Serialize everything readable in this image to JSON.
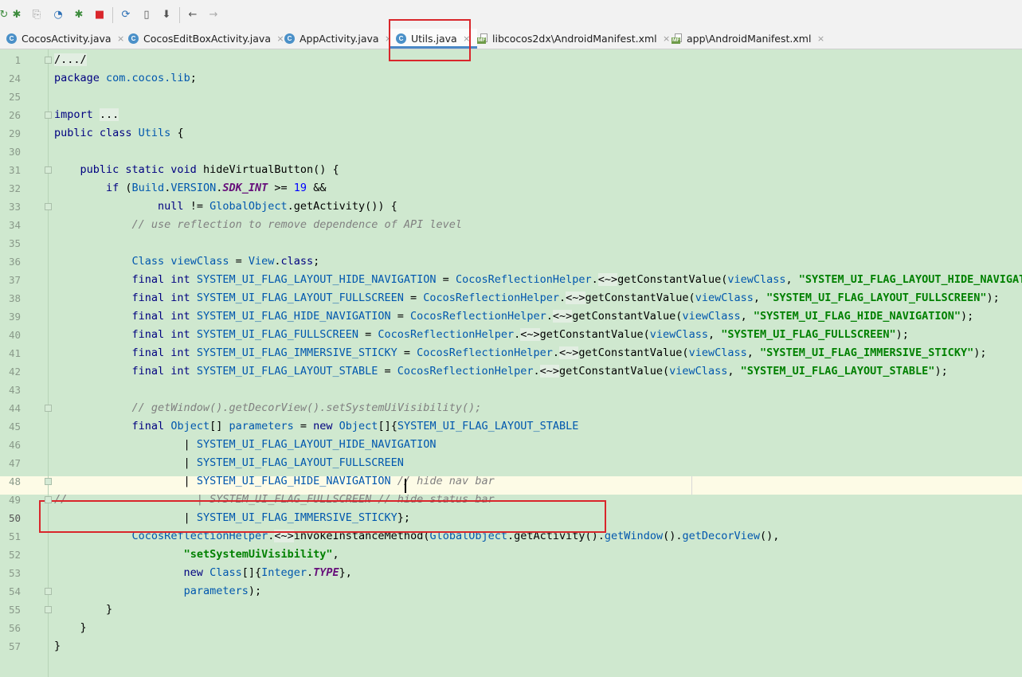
{
  "toolbar": {
    "buttons": [
      {
        "icon": "rerun-icon"
      },
      {
        "icon": "debug-icon"
      },
      {
        "icon": "attach-debugger-icon"
      },
      {
        "icon": "profile-icon"
      },
      {
        "icon": "run-with-coverage-icon"
      },
      {
        "icon": "stop-icon"
      },
      {
        "icon": "sync-gradle-icon"
      },
      {
        "icon": "avd-manager-icon"
      },
      {
        "icon": "sdk-manager-icon"
      },
      {
        "icon": "back-arrow-icon"
      },
      {
        "icon": "forward-arrow-icon"
      }
    ],
    "glyphs": {
      "rerun": "↻",
      "debug": "✱",
      "attach": "⎘",
      "profile": "◔",
      "coverage": "✱",
      "stop": "■",
      "sync": "⟳",
      "avd": "▯",
      "sdk": "⬇",
      "back": "←",
      "forward": "→"
    },
    "colors": {
      "green": "#3d8c3d",
      "stop": "#d9262b",
      "gray": "#777777",
      "blue": "#2c6fb5"
    }
  },
  "tabs": [
    {
      "label": "CocosActivity.java",
      "icon": "C",
      "close": "×"
    },
    {
      "label": "CocosEditBoxActivity.java",
      "icon": "C",
      "close": "×"
    },
    {
      "label": "AppActivity.java",
      "icon": "C",
      "close": "×"
    },
    {
      "label": "Utils.java",
      "icon": "C",
      "close": "×",
      "active": true
    },
    {
      "label": "libcocos2dx\\AndroidManifest.xml",
      "icon": "MF",
      "close": "×"
    },
    {
      "label": "app\\AndroidManifest.xml",
      "icon": "MF",
      "close": "×"
    }
  ],
  "editor": {
    "line_numbers": [
      "1",
      "24",
      "25",
      "26",
      "29",
      "30",
      "31",
      "32",
      "33",
      "34",
      "35",
      "36",
      "37",
      "38",
      "39",
      "40",
      "41",
      "42",
      "43",
      "44",
      "45",
      "46",
      "47",
      "48",
      "49",
      "50",
      "51",
      "52",
      "53",
      "54",
      "55",
      "56",
      "57"
    ],
    "lines": [
      [
        {
          "t": "/.../",
          "c": "fold-g"
        }
      ],
      [
        {
          "t": "package ",
          "c": "kw"
        },
        {
          "t": "com.cocos.lib",
          "c": "ty"
        },
        {
          "t": ";"
        }
      ],
      [],
      [
        {
          "t": "import ",
          "c": "kw"
        },
        {
          "t": "...",
          "c": "fold-g"
        }
      ],
      [
        {
          "t": "public class ",
          "c": "kw"
        },
        {
          "t": "Utils",
          "c": "ty"
        },
        {
          "t": " {"
        }
      ],
      [],
      [
        {
          "t": "    public static void ",
          "c": "kw"
        },
        {
          "t": "hideVirtualButton() {"
        }
      ],
      [
        {
          "t": "        if ",
          "c": "kw"
        },
        {
          "t": "("
        },
        {
          "t": "Build",
          "c": "ty"
        },
        {
          "t": "."
        },
        {
          "t": "VERSION",
          "c": "ty"
        },
        {
          "t": "."
        },
        {
          "t": "SDK_INT",
          "c": "fld"
        },
        {
          "t": " >= "
        },
        {
          "t": "19",
          "c": "num"
        },
        {
          "t": " &&"
        }
      ],
      [
        {
          "t": "                null ",
          "c": "kw"
        },
        {
          "t": "!= "
        },
        {
          "t": "GlobalObject",
          "c": "ty"
        },
        {
          "t": ".getActivity()) {"
        }
      ],
      [
        {
          "t": "            // use reflection to remove dependence of API level",
          "c": "cmt"
        }
      ],
      [],
      [
        {
          "t": "            Class ",
          "c": "ty"
        },
        {
          "t": "viewClass",
          "c": "ty"
        },
        {
          "t": " = "
        },
        {
          "t": "View",
          "c": "ty"
        },
        {
          "t": "."
        },
        {
          "t": "class",
          "c": "kw"
        },
        {
          "t": ";"
        }
      ],
      [
        {
          "t": "            final int ",
          "c": "kw"
        },
        {
          "t": "SYSTEM_UI_FLAG_LAYOUT_HIDE_NAVIGATION",
          "c": "ty"
        },
        {
          "t": " = "
        },
        {
          "t": "CocosReflectionHelper",
          "c": "ty"
        },
        {
          "t": "."
        },
        {
          "t": "<~>",
          "c": "fold-g"
        },
        {
          "t": "getConstantValue("
        },
        {
          "t": "viewClass",
          "c": "ty"
        },
        {
          "t": ", "
        },
        {
          "t": "\"SYSTEM_UI_FLAG_LAYOUT_HIDE_NAVIGATION\"",
          "c": "str"
        },
        {
          "t": ");"
        }
      ],
      [
        {
          "t": "            final int ",
          "c": "kw"
        },
        {
          "t": "SYSTEM_UI_FLAG_LAYOUT_FULLSCREEN",
          "c": "ty"
        },
        {
          "t": " = "
        },
        {
          "t": "CocosReflectionHelper",
          "c": "ty"
        },
        {
          "t": "."
        },
        {
          "t": "<~>",
          "c": "fold-g"
        },
        {
          "t": "getConstantValue("
        },
        {
          "t": "viewClass",
          "c": "ty"
        },
        {
          "t": ", "
        },
        {
          "t": "\"SYSTEM_UI_FLAG_LAYOUT_FULLSCREEN\"",
          "c": "str"
        },
        {
          "t": ");"
        }
      ],
      [
        {
          "t": "            final int ",
          "c": "kw"
        },
        {
          "t": "SYSTEM_UI_FLAG_HIDE_NAVIGATION",
          "c": "ty"
        },
        {
          "t": " = "
        },
        {
          "t": "CocosReflectionHelper",
          "c": "ty"
        },
        {
          "t": "."
        },
        {
          "t": "<~>",
          "c": "fold-g"
        },
        {
          "t": "getConstantValue("
        },
        {
          "t": "viewClass",
          "c": "ty"
        },
        {
          "t": ", "
        },
        {
          "t": "\"SYSTEM_UI_FLAG_HIDE_NAVIGATION\"",
          "c": "str"
        },
        {
          "t": ");"
        }
      ],
      [
        {
          "t": "            final int ",
          "c": "kw"
        },
        {
          "t": "SYSTEM_UI_FLAG_FULLSCREEN",
          "c": "ty"
        },
        {
          "t": " = "
        },
        {
          "t": "CocosReflectionHelper",
          "c": "ty"
        },
        {
          "t": "."
        },
        {
          "t": "<~>",
          "c": "fold-g"
        },
        {
          "t": "getConstantValue("
        },
        {
          "t": "viewClass",
          "c": "ty"
        },
        {
          "t": ", "
        },
        {
          "t": "\"SYSTEM_UI_FLAG_FULLSCREEN\"",
          "c": "str"
        },
        {
          "t": ");"
        }
      ],
      [
        {
          "t": "            final int ",
          "c": "kw"
        },
        {
          "t": "SYSTEM_UI_FLAG_IMMERSIVE_STICKY",
          "c": "ty"
        },
        {
          "t": " = "
        },
        {
          "t": "CocosReflectionHelper",
          "c": "ty"
        },
        {
          "t": "."
        },
        {
          "t": "<~>",
          "c": "fold-g"
        },
        {
          "t": "getConstantValue("
        },
        {
          "t": "viewClass",
          "c": "ty"
        },
        {
          "t": ", "
        },
        {
          "t": "\"SYSTEM_UI_FLAG_IMMERSIVE_STICKY\"",
          "c": "str"
        },
        {
          "t": ");"
        }
      ],
      [
        {
          "t": "            final int ",
          "c": "kw"
        },
        {
          "t": "SYSTEM_UI_FLAG_LAYOUT_STABLE",
          "c": "ty"
        },
        {
          "t": " = "
        },
        {
          "t": "CocosReflectionHelper",
          "c": "ty"
        },
        {
          "t": "."
        },
        {
          "t": "<~>",
          "c": "fold-g"
        },
        {
          "t": "getConstantValue("
        },
        {
          "t": "viewClass",
          "c": "ty"
        },
        {
          "t": ", "
        },
        {
          "t": "\"SYSTEM_UI_FLAG_LAYOUT_STABLE\"",
          "c": "str"
        },
        {
          "t": ");"
        }
      ],
      [],
      [
        {
          "t": "            // getWindow().getDecorView().setSystemUiVisibility();",
          "c": "cmt"
        }
      ],
      [
        {
          "t": "            final ",
          "c": "kw"
        },
        {
          "t": "Object",
          "c": "ty"
        },
        {
          "t": "[] "
        },
        {
          "t": "parameters",
          "c": "ty"
        },
        {
          "t": " = "
        },
        {
          "t": "new ",
          "c": "kw"
        },
        {
          "t": "Object",
          "c": "ty"
        },
        {
          "t": "[]{"
        },
        {
          "t": "SYSTEM_UI_FLAG_LAYOUT_STABLE",
          "c": "ty"
        }
      ],
      [
        {
          "t": "                    | "
        },
        {
          "t": "SYSTEM_UI_FLAG_LAYOUT_HIDE_NAVIGATION",
          "c": "ty"
        }
      ],
      [
        {
          "t": "                    | "
        },
        {
          "t": "SYSTEM_UI_FLAG_LAYOUT_FULLSCREEN",
          "c": "ty"
        }
      ],
      [
        {
          "t": "                    | "
        },
        {
          "t": "SYSTEM_UI_FLAG_HIDE_NAVIGATION",
          "c": "ty"
        },
        {
          "t": " // hide nav bar",
          "c": "cmt"
        }
      ],
      [
        {
          "t": "//                    | SYSTEM_UI_FLAG_FULLSCREEN // hide status bar",
          "c": "cmt"
        }
      ],
      [
        {
          "t": "                    | "
        },
        {
          "t": "SYSTEM_UI_FLAG_IMMERSIVE_STICKY",
          "c": "ty"
        },
        {
          "t": "};"
        }
      ],
      [
        {
          "t": "            "
        },
        {
          "t": "CocosReflectionHelper",
          "c": "ty"
        },
        {
          "t": "."
        },
        {
          "t": "<~>",
          "c": "fold-g"
        },
        {
          "t": "invokeInstanceMethod("
        },
        {
          "t": "GlobalObject",
          "c": "ty"
        },
        {
          "t": ".getActivity()."
        },
        {
          "t": "getWindow",
          "c": "ty"
        },
        {
          "t": "()."
        },
        {
          "t": "getDecorView",
          "c": "ty"
        },
        {
          "t": "(),"
        }
      ],
      [
        {
          "t": "                    "
        },
        {
          "t": "\"setSystemUiVisibility\"",
          "c": "str"
        },
        {
          "t": ","
        }
      ],
      [
        {
          "t": "                    new ",
          "c": "kw"
        },
        {
          "t": "Class",
          "c": "ty"
        },
        {
          "t": "[]{"
        },
        {
          "t": "Integer",
          "c": "ty"
        },
        {
          "t": "."
        },
        {
          "t": "TYPE",
          "c": "fld"
        },
        {
          "t": "},"
        }
      ],
      [
        {
          "t": "                    "
        },
        {
          "t": "parameters",
          "c": "ty"
        },
        {
          "t": ");"
        }
      ],
      [
        {
          "t": "        }"
        }
      ],
      [
        {
          "t": "    }"
        }
      ],
      [
        {
          "t": "}"
        }
      ]
    ]
  }
}
